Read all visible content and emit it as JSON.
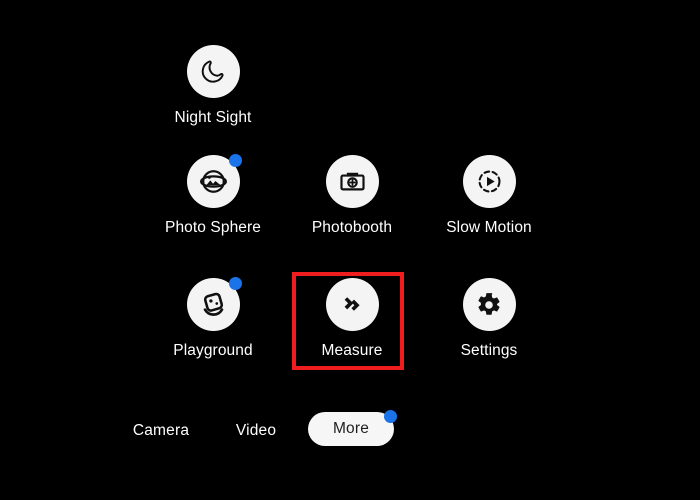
{
  "theme": {
    "background": "#000000",
    "icon_circle": "#f4f4f4",
    "icon_glyph": "#111111",
    "label_color": "#ffffff",
    "badge_blue": "#1a73e8",
    "highlight_red": "#ef1d1d",
    "pill_background": "#f6f6f6",
    "pill_text": "#1f1f1f"
  },
  "modes": [
    {
      "id": "night-sight",
      "label": "Night Sight",
      "icon": "moon-icon",
      "badge": false,
      "row": 1,
      "col": 1
    },
    {
      "id": "photo-sphere",
      "label": "Photo Sphere",
      "icon": "photo-sphere-icon",
      "badge": true,
      "row": 2,
      "col": 1
    },
    {
      "id": "photobooth",
      "label": "Photobooth",
      "icon": "photobooth-camera-icon",
      "badge": false,
      "row": 2,
      "col": 2
    },
    {
      "id": "slow-motion",
      "label": "Slow Motion",
      "icon": "slow-motion-play-icon",
      "badge": false,
      "row": 2,
      "col": 3
    },
    {
      "id": "playground",
      "label": "Playground",
      "icon": "playground-character-icon",
      "badge": true,
      "row": 3,
      "col": 1
    },
    {
      "id": "measure",
      "label": "Measure",
      "icon": "measure-arrow-icon",
      "badge": false,
      "row": 3,
      "col": 2,
      "highlighted": true
    },
    {
      "id": "settings",
      "label": "Settings",
      "icon": "gear-icon",
      "badge": false,
      "row": 3,
      "col": 3
    }
  ],
  "bottom_bar": {
    "camera_label": "Camera",
    "video_label": "Video",
    "more_label": "More",
    "more_selected": true,
    "more_badge": true
  }
}
